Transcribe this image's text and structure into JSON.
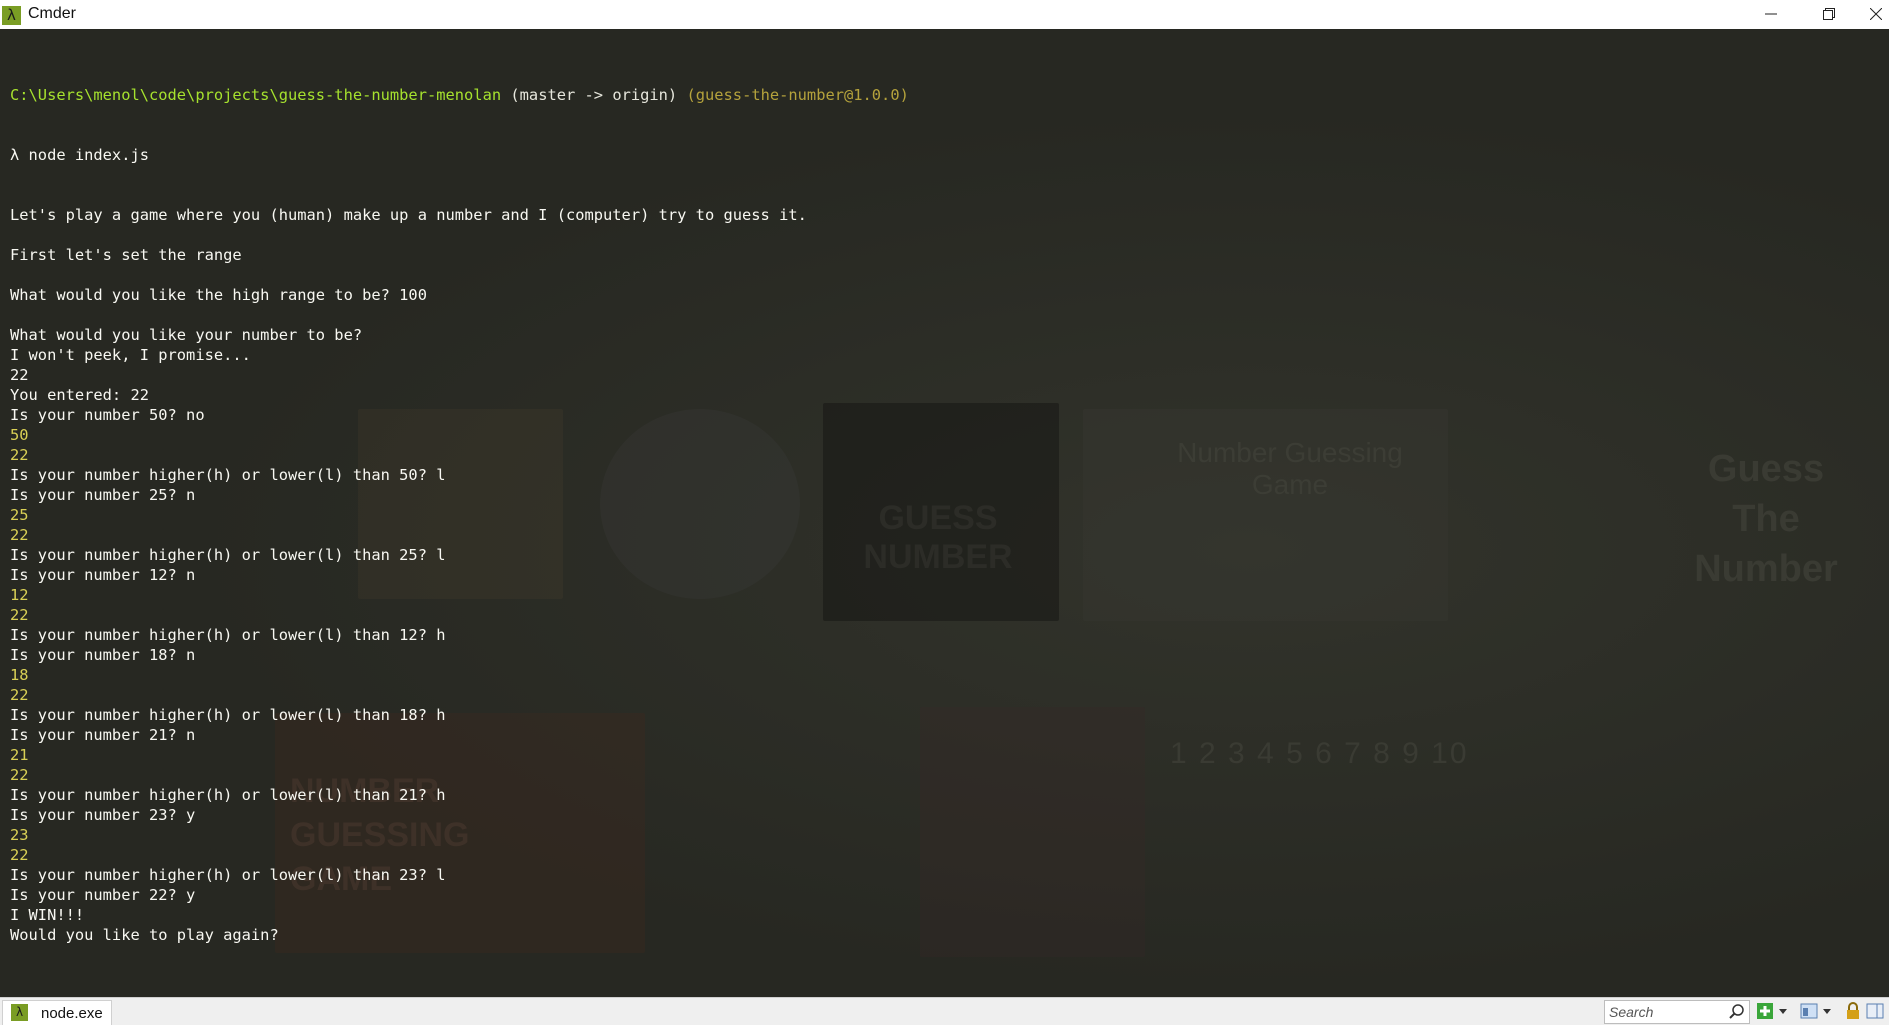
{
  "window": {
    "title": "Cmder",
    "logo_glyph": "λ"
  },
  "console": {
    "prompt": {
      "path": "C:\\Users\\menol\\code\\projects\\guess-the-number-menolan",
      "branch": "(master -> origin)",
      "package": "(guess-the-number@1.0.0)"
    },
    "command": "λ node index.js",
    "lines": [
      "Let's play a game where you (human) make up a number and I (computer) try to guess it.",
      "",
      "First let's set the range",
      "",
      "What would you like the high range to be? 100",
      "",
      "What would you like your number to be?",
      "I won't peek, I promise...",
      "22",
      "You entered: 22",
      "Is your number 50? no",
      "50",
      "22",
      "Is your number higher(h) or lower(l) than 50? l",
      "Is your number 25? n",
      "25",
      "22",
      "Is your number higher(h) or lower(l) than 25? l",
      "Is your number 12? n",
      "12",
      "22",
      "Is your number higher(h) or lower(l) than 12? h",
      "Is your number 18? n",
      "18",
      "22",
      "Is your number higher(h) or lower(l) than 18? h",
      "Is your number 21? n",
      "21",
      "22",
      "Is your number higher(h) or lower(l) than 21? h",
      "Is your number 23? y",
      "23",
      "22",
      "Is your number higher(h) or lower(l) than 23? l",
      "Is your number 22? y",
      "I WIN!!!",
      "Would you like to play again?"
    ]
  },
  "background": {
    "texts": [
      "Guess The Number",
      "Number Guessing Game",
      "GUESS NUMBER",
      "NUMBER GUESSING GAME",
      "1 2 3 4 5 6 7 8 9 10"
    ]
  },
  "taskbar": {
    "tab_label": "node.exe",
    "tab_icon_glyph": "λ",
    "search_placeholder": "Search"
  },
  "colors": {
    "console_bg": "#272822",
    "text": "#f8f8f2",
    "path": "#a6e22e",
    "package": "#b4a23c",
    "numbers": "#d9d055",
    "logo": "#7a9d24"
  }
}
